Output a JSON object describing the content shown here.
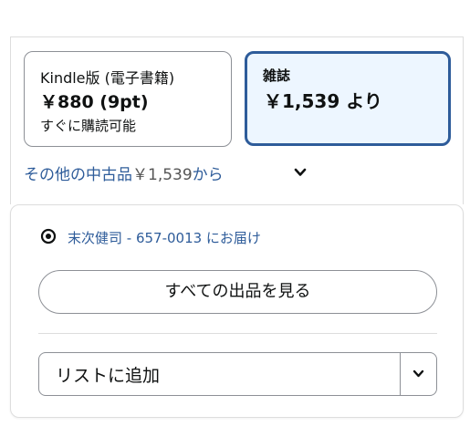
{
  "formats": {
    "kindle": {
      "name": "Kindle版 (電子書籍)",
      "price": "￥880 (9pt)",
      "availability": "すぐに購読可能"
    },
    "magazine": {
      "name": "雑誌",
      "price": "￥1,539 より",
      "selected": true
    }
  },
  "used": {
    "label": "その他の中古品",
    "price": "￥1,539",
    "suffix": "から"
  },
  "delivery": {
    "text": "末次健司 - 657-0013 にお届け"
  },
  "buttons": {
    "see_all": "すべての出品を見る",
    "add_to_list": "リストに追加"
  },
  "icons": {
    "location": "location-pin-icon",
    "chevron": "chevron-down-icon",
    "dropdown": "chevron-down-icon"
  },
  "colors": {
    "link": "#2e5c9a",
    "selected_border": "#2e5c9a",
    "selected_bg": "#edf6ff"
  }
}
